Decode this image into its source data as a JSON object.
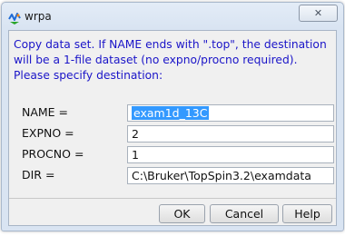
{
  "window": {
    "title": "wrpa",
    "app_icon": "topspin-app-icon",
    "close_icon": "close-icon",
    "close_glyph": "✕"
  },
  "message": {
    "lines": [
      "Copy data set. If NAME ends with \".top\", the destination",
      "will be a 1-file dataset (no expno/procno required).",
      "Please specify destination:"
    ],
    "color": "#1a14c8"
  },
  "fields": {
    "name": {
      "label": "NAME =",
      "value": "exam1d_13C",
      "selected": true
    },
    "expno": {
      "label": "EXPNO =",
      "value": "2"
    },
    "procno": {
      "label": "PROCNO =",
      "value": "1"
    },
    "dir": {
      "label": "DIR =",
      "value": "C:\\Bruker\\TopSpin3.2\\examdata"
    }
  },
  "buttons": {
    "ok": "OK",
    "cancel": "Cancel",
    "help": "Help"
  },
  "colors": {
    "selection": "#3399ff",
    "window_frame": "#d9e4f2",
    "client_bg": "#f0f0f0"
  }
}
